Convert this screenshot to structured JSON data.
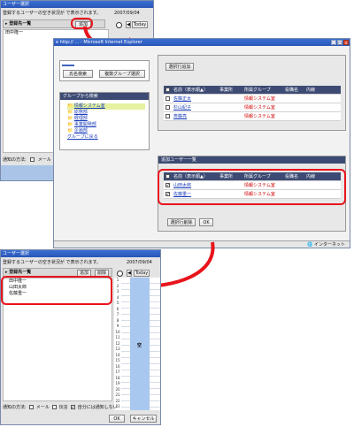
{
  "top_window": {
    "title": "ユーザー選択",
    "info_text": "登録するユーザーの空き状況が ",
    "info_text_tail": " で表示されます。",
    "date": "2007/09/04",
    "list_label": "登録先一覧",
    "add_button": "追加",
    "today_button": "Today",
    "entries": [
      "田中隆一"
    ],
    "notify_label": "通知の方法:",
    "mail_label": "メール"
  },
  "browser": {
    "title": "http:// ... - Microsoft Internet Explorer",
    "btn_name_search": "氏名検索",
    "btn_multi_group": "複数グループ選択",
    "group_panel_title": "グループから検索",
    "groups": [
      "情報システム室",
      "総務部",
      "経理部",
      "事業開発部",
      "企画部"
    ],
    "group_more": "グループに戻る",
    "btn_add_selected": "選択行追加",
    "table_headers": [
      "名前（表示順▲）",
      "事業所",
      "所属グループ",
      "役職名",
      "内線"
    ],
    "candidates": [
      {
        "name": "佐藤正太",
        "group": "情報システム室"
      },
      {
        "name": "杉山紀子",
        "group": "情報システム室"
      },
      {
        "name": "斎藤亮",
        "group": "情報システム室"
      }
    ],
    "added_title": "追加ユーザー一覧",
    "added": [
      {
        "name": "山田太郎",
        "group": "情報システム室"
      },
      {
        "name": "佐藤重一",
        "group": "情報システム室"
      }
    ],
    "btn_remove_selected": "選択行削除",
    "btn_ok": "OK",
    "status_zone": "インターネット"
  },
  "bottom_window": {
    "title": "ユーザー選択",
    "info_text": "登録するユーザーの空き状況が ",
    "info_text_tail": " で表示されます。",
    "date": "2007/09/04",
    "list_label": "登録先一覧",
    "add_button": "追加",
    "delete_button": "削除",
    "today_button": "Today",
    "entries": [
      "田中隆一",
      "山田太郎",
      "佐藤重一"
    ],
    "hours": [
      "1",
      "2",
      "3",
      "4",
      "5",
      "6",
      "7",
      "8",
      "9",
      "10",
      "11",
      "12",
      "13",
      "14",
      "15",
      "16",
      "17",
      "18",
      "19",
      "20",
      "21",
      "22",
      "23"
    ],
    "free_label": "空",
    "notify_label": "通知の方法:",
    "mail_label": "メール",
    "phone_label": "伝言",
    "self_notify_label": "自分には通知しない",
    "ok_button": "OK",
    "cancel_button": "キャンセル"
  },
  "colors": {
    "callout": "#e8141c",
    "header_dark": "#3d4b74",
    "today_col": "#a9c8f0",
    "titlebar": "#2a55b8"
  }
}
